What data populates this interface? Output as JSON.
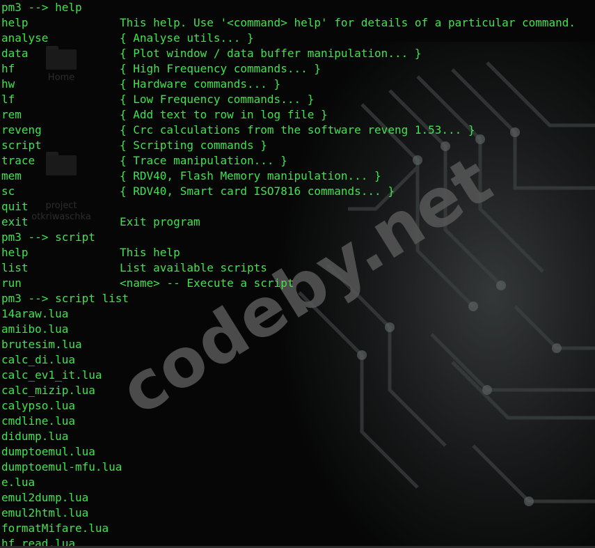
{
  "desktop_icons": [
    {
      "label": "Home"
    },
    {
      "label": "project\notkriwaschka"
    }
  ],
  "watermark": "codeby.net",
  "terminal": {
    "lines": [
      {
        "cmd": "pm3 --> help",
        "desc": ""
      },
      {
        "cmd": "help",
        "desc": "This help. Use '<command> help' for details of a particular command."
      },
      {
        "cmd": "analyse",
        "desc": "{ Analyse utils... }"
      },
      {
        "cmd": "data",
        "desc": "{ Plot window / data buffer manipulation... }"
      },
      {
        "cmd": "hf",
        "desc": "{ High Frequency commands... }"
      },
      {
        "cmd": "hw",
        "desc": "{ Hardware commands... }"
      },
      {
        "cmd": "lf",
        "desc": "{ Low Frequency commands... }"
      },
      {
        "cmd": "rem",
        "desc": "{ Add text to row in log file }"
      },
      {
        "cmd": "reveng",
        "desc": "{ Crc calculations from the software reveng 1.53... }"
      },
      {
        "cmd": "script",
        "desc": "{ Scripting commands }"
      },
      {
        "cmd": "trace",
        "desc": "{ Trace manipulation... }"
      },
      {
        "cmd": "mem",
        "desc": "{ RDV40, Flash Memory manipulation... }"
      },
      {
        "cmd": "sc",
        "desc": "{ RDV40, Smart card ISO7816 commands... }"
      },
      {
        "cmd": "quit",
        "desc": ""
      },
      {
        "cmd": "exit",
        "desc": "Exit program"
      },
      {
        "cmd": "pm3 --> script",
        "desc": ""
      },
      {
        "cmd": "help",
        "desc": "This help"
      },
      {
        "cmd": "list",
        "desc": "List available scripts"
      },
      {
        "cmd": "run",
        "desc": "<name> -- Execute a script"
      },
      {
        "cmd": "pm3 --> script list",
        "desc": ""
      },
      {
        "cmd": "14araw.lua",
        "desc": ""
      },
      {
        "cmd": "amiibo.lua",
        "desc": ""
      },
      {
        "cmd": "brutesim.lua",
        "desc": ""
      },
      {
        "cmd": "calc_di.lua",
        "desc": ""
      },
      {
        "cmd": "calc_ev1_it.lua",
        "desc": ""
      },
      {
        "cmd": "calc_mizip.lua",
        "desc": ""
      },
      {
        "cmd": "calypso.lua",
        "desc": ""
      },
      {
        "cmd": "cmdline.lua",
        "desc": ""
      },
      {
        "cmd": "didump.lua",
        "desc": ""
      },
      {
        "cmd": "dumptoemul.lua",
        "desc": ""
      },
      {
        "cmd": "dumptoemul-mfu.lua",
        "desc": ""
      },
      {
        "cmd": "e.lua",
        "desc": ""
      },
      {
        "cmd": "emul2dump.lua",
        "desc": ""
      },
      {
        "cmd": "emul2html.lua",
        "desc": ""
      },
      {
        "cmd": "formatMifare.lua",
        "desc": ""
      },
      {
        "cmd": "hf_read.lua",
        "desc": ""
      }
    ]
  },
  "colors": {
    "text": "#3fe44e",
    "background": "#050605"
  }
}
